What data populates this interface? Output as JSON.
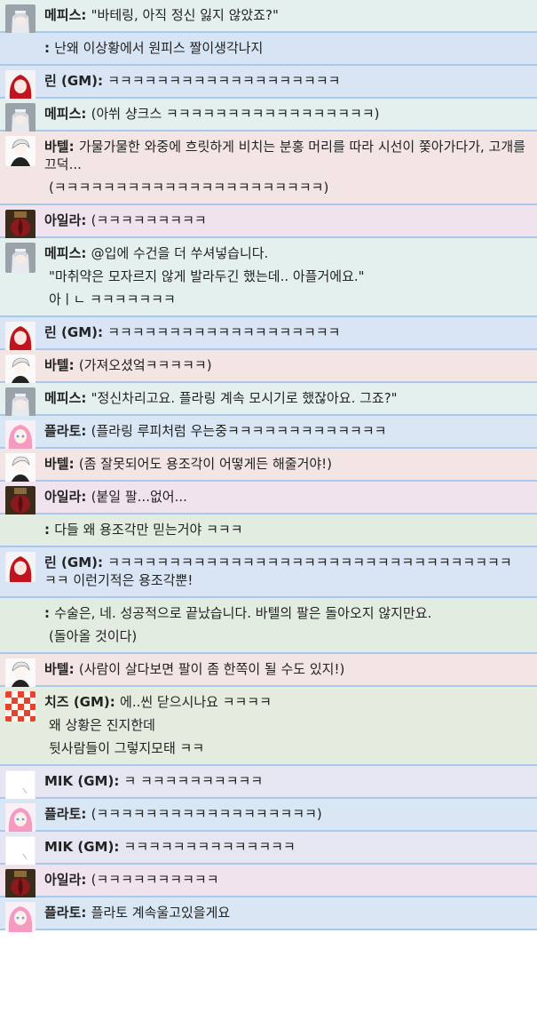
{
  "messages": [
    {
      "speaker": "메피스",
      "avatar": "mephis-avatar",
      "bg": "bg-mephis",
      "lines": [
        "\"바테링, 아직 정신 잃지 않았죠?\""
      ]
    },
    {
      "speaker": "",
      "avatar": "",
      "bg": "bg-blue",
      "lines": [
        "난왜 이상황에서 원피스 짤이생각나지"
      ]
    },
    {
      "speaker": "린 (GM)",
      "avatar": "rin-avatar",
      "bg": "bg-rin",
      "lines": [
        "ㅋㅋㅋㅋㅋㅋㅋㅋㅋㅋㅋㅋㅋㅋㅋㅋㅋㅋㅋ"
      ]
    },
    {
      "speaker": "메피스",
      "avatar": "mephis-avatar",
      "bg": "bg-mephis",
      "lines": [
        "(아쒸 샹크스 ㅋㅋㅋㅋㅋㅋㅋㅋㅋㅋㅋㅋㅋㅋㅋㅋㅋ)"
      ]
    },
    {
      "speaker": "바텔",
      "avatar": "batel-avatar",
      "bg": "bg-batel",
      "lines": [
        "가물가물한 와중에 흐릿하게 비치는 분홍 머리를 따라 시선이 쫓아가다가, 고개를 끄덕...",
        "(ㅋㅋㅋㅋㅋㅋㅋㅋㅋㅋㅋㅋㅋㅋㅋㅋㅋㅋㅋㅋㅋㅋ)"
      ]
    },
    {
      "speaker": "아일라",
      "avatar": "aila-avatar",
      "bg": "bg-aila",
      "lines": [
        "(ㅋㅋㅋㅋㅋㅋㅋㅋㅋ"
      ]
    },
    {
      "speaker": "메피스",
      "avatar": "mephis-avatar",
      "bg": "bg-mephis",
      "lines": [
        "@입에 수건을 더 쑤셔넣습니다.",
        "\"마취약은 모자르지 않게 발라두긴 했는데.. 아플거에요.\"",
        "아ㅣㄴ ㅋㅋㅋㅋㅋㅋㅋ"
      ]
    },
    {
      "speaker": "린 (GM)",
      "avatar": "rin-avatar",
      "bg": "bg-rin",
      "lines": [
        "ㅋㅋㅋㅋㅋㅋㅋㅋㅋㅋㅋㅋㅋㅋㅋㅋㅋㅋㅋ"
      ]
    },
    {
      "speaker": "바텔",
      "avatar": "batel-avatar",
      "bg": "bg-batel",
      "lines": [
        "(가져오셨엌ㅋㅋㅋㅋㅋ)"
      ]
    },
    {
      "speaker": "메피스",
      "avatar": "mephis-avatar",
      "bg": "bg-mephis",
      "lines": [
        "\"정신차리고요. 플라링 계속 모시기로 했잖아요. 그죠?\""
      ]
    },
    {
      "speaker": "플라토",
      "avatar": "plato-avatar",
      "bg": "bg-plato",
      "lines": [
        "(플라링 루피처럼 우는중ㅋㅋㅋㅋㅋㅋㅋㅋㅋㅋㅋㅋㅋ"
      ]
    },
    {
      "speaker": "바텔",
      "avatar": "batel-avatar",
      "bg": "bg-batel",
      "lines": [
        "(좀 잘못되어도 용조각이 어떻게든 해줄거야!)"
      ]
    },
    {
      "speaker": "아일라",
      "avatar": "aila-avatar",
      "bg": "bg-aila",
      "lines": [
        "(붙일 팔...없어..."
      ]
    },
    {
      "speaker": "",
      "avatar": "",
      "bg": "bg-green",
      "lines": [
        "다들 왜 용조각만 믿는거야 ㅋㅋㅋ"
      ]
    },
    {
      "speaker": "린 (GM)",
      "avatar": "rin-avatar",
      "bg": "bg-rin",
      "lines": [
        "ㅋㅋㅋㅋㅋㅋㅋㅋㅋㅋㅋㅋㅋㅋㅋㅋㅋㅋㅋㅋㅋㅋㅋㅋㅋㅋㅋㅋㅋㅋㅋㅋㅋ ㅋㅋ 이런기적은 용조각뿐!"
      ]
    },
    {
      "speaker": "",
      "avatar": "",
      "bg": "bg-green",
      "lines": [
        "수술은, 네. 성공적으로 끝났습니다. 바텔의 팔은 돌아오지 않지만요.",
        "(돌아올 것이다)"
      ]
    },
    {
      "speaker": "바텔",
      "avatar": "batel-avatar",
      "bg": "bg-batel",
      "lines": [
        "(사람이 살다보면 팔이 좀 한쪽이 될 수도 있지!)"
      ]
    },
    {
      "speaker": "치즈 (GM)",
      "avatar": "chiz-avatar",
      "bg": "bg-chiz",
      "lines": [
        "에..씬 닫으시나요 ㅋㅋㅋㅋ",
        "왜 상황은 진지한데",
        "뒷사람들이 그렇지모태 ㅋㅋ"
      ]
    },
    {
      "speaker": "MIK (GM)",
      "avatar": "mik-avatar",
      "bg": "bg-mik",
      "lines": [
        "ㅋ ㅋㅋㅋㅋㅋㅋㅋㅋㅋㅋ"
      ]
    },
    {
      "speaker": "플라토",
      "avatar": "plato-avatar",
      "bg": "bg-plato",
      "lines": [
        "(ㅋㅋㅋㅋㅋㅋㅋㅋㅋㅋㅋㅋㅋㅋㅋㅋㅋㅋ)"
      ]
    },
    {
      "speaker": "MIK (GM)",
      "avatar": "mik-avatar",
      "bg": "bg-mik",
      "lines": [
        "ㅋㅋㅋㅋㅋㅋㅋㅋㅋㅋㅋㅋㅋㅋ"
      ]
    },
    {
      "speaker": "아일라",
      "avatar": "aila-avatar",
      "bg": "bg-aila",
      "lines": [
        "(ㅋㅋㅋㅋㅋㅋㅋㅋㅋㅋ"
      ]
    },
    {
      "speaker": "플라토",
      "avatar": "plato-avatar",
      "bg": "bg-plato",
      "lines": [
        "플라토 계속울고있을게요"
      ]
    }
  ]
}
